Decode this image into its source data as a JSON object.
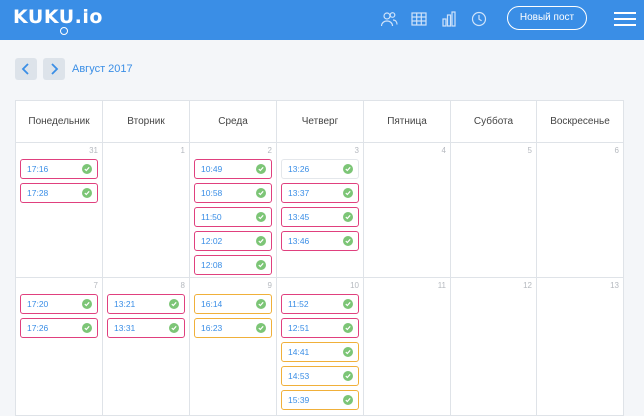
{
  "app": {
    "logo": "KUKU.io"
  },
  "header": {
    "new_post_label": "Новый пост",
    "icons": [
      "users-icon",
      "table-icon",
      "bar-chart-icon",
      "clock-icon"
    ]
  },
  "calendar_nav": {
    "month_label": "Август 2017"
  },
  "weekdays": [
    "Понедельник",
    "Вторник",
    "Среда",
    "Четверг",
    "Пятница",
    "Суббота",
    "Воскресенье"
  ],
  "weeks": [
    {
      "days": [
        {
          "num": "31",
          "posts": [
            {
              "time": "17:16",
              "style": "pink"
            },
            {
              "time": "17:28",
              "style": "pink"
            }
          ]
        },
        {
          "num": "1",
          "posts": []
        },
        {
          "num": "2",
          "posts": [
            {
              "time": "10:49",
              "style": "pink"
            },
            {
              "time": "10:58",
              "style": "pink"
            },
            {
              "time": "11:50",
              "style": "pink"
            },
            {
              "time": "12:02",
              "style": "pink"
            },
            {
              "time": "12:08",
              "style": "pink"
            }
          ]
        },
        {
          "num": "3",
          "posts": [
            {
              "time": "13:26",
              "style": "plain"
            },
            {
              "time": "13:37",
              "style": "pink"
            },
            {
              "time": "13:45",
              "style": "pink"
            },
            {
              "time": "13:46",
              "style": "pink"
            }
          ]
        },
        {
          "num": "4",
          "posts": []
        },
        {
          "num": "5",
          "posts": []
        },
        {
          "num": "6",
          "posts": []
        }
      ]
    },
    {
      "days": [
        {
          "num": "7",
          "posts": [
            {
              "time": "17:20",
              "style": "pink"
            },
            {
              "time": "17:26",
              "style": "pink"
            }
          ]
        },
        {
          "num": "8",
          "posts": [
            {
              "time": "13:21",
              "style": "pink"
            },
            {
              "time": "13:31",
              "style": "pink"
            }
          ]
        },
        {
          "num": "9",
          "posts": [
            {
              "time": "16:14",
              "style": "orange"
            },
            {
              "time": "16:23",
              "style": "orange"
            }
          ]
        },
        {
          "num": "10",
          "posts": [
            {
              "time": "11:52",
              "style": "pink"
            },
            {
              "time": "12:51",
              "style": "pink"
            },
            {
              "time": "14:41",
              "style": "orange"
            },
            {
              "time": "14:53",
              "style": "orange"
            },
            {
              "time": "15:39",
              "style": "orange"
            }
          ]
        },
        {
          "num": "11",
          "posts": []
        },
        {
          "num": "12",
          "posts": []
        },
        {
          "num": "13",
          "posts": []
        }
      ]
    }
  ],
  "colors": {
    "accent": "#3a8ee6",
    "pink_border": "#e0407e",
    "orange_border": "#f0b03a",
    "check": "#7cc576"
  }
}
